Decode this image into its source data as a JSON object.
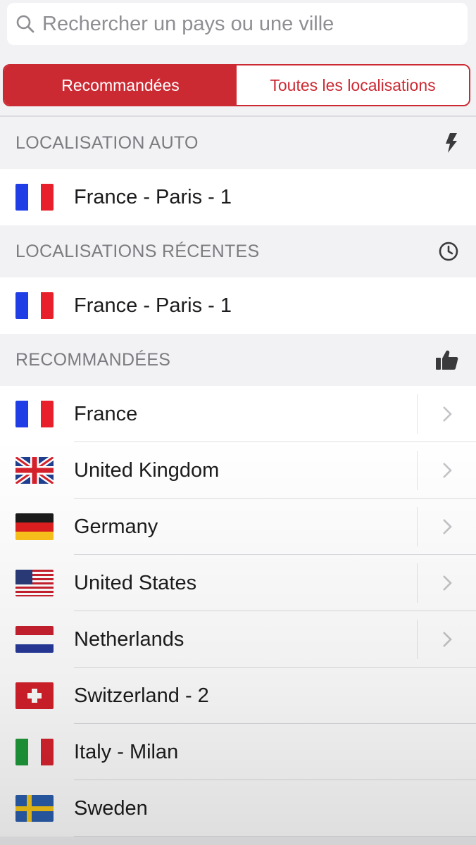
{
  "search": {
    "placeholder": "Rechercher un pays ou une ville"
  },
  "tabs": [
    {
      "label": "Recommandées",
      "active": true
    },
    {
      "label": "Toutes les localisations",
      "active": false
    }
  ],
  "sections": {
    "auto": {
      "title": "LOCALISATION AUTO",
      "icon": "lightning-icon",
      "item": "France - Paris - 1"
    },
    "recent": {
      "title": "LOCALISATIONS RÉCENTES",
      "icon": "clock-icon",
      "item": "France - Paris - 1"
    },
    "recommended": {
      "title": "RECOMMANDÉES",
      "icon": "thumbs-up-icon",
      "items": [
        {
          "label": "France",
          "flag": "france-flag",
          "has_chevron": true
        },
        {
          "label": "United Kingdom",
          "flag": "uk-flag",
          "has_chevron": true
        },
        {
          "label": "Germany",
          "flag": "germany-flag",
          "has_chevron": true
        },
        {
          "label": "United States",
          "flag": "us-flag",
          "has_chevron": true
        },
        {
          "label": "Netherlands",
          "flag": "netherlands-flag",
          "has_chevron": true
        },
        {
          "label": "Switzerland - 2",
          "flag": "switzerland-flag",
          "has_chevron": false
        },
        {
          "label": "Italy - Milan",
          "flag": "italy-flag",
          "has_chevron": false
        },
        {
          "label": "Sweden",
          "flag": "sweden-flag",
          "has_chevron": false
        }
      ]
    }
  },
  "colors": {
    "accent": "#cc2a33",
    "header_text": "#7b7b80",
    "background": "#f2f2f4"
  }
}
